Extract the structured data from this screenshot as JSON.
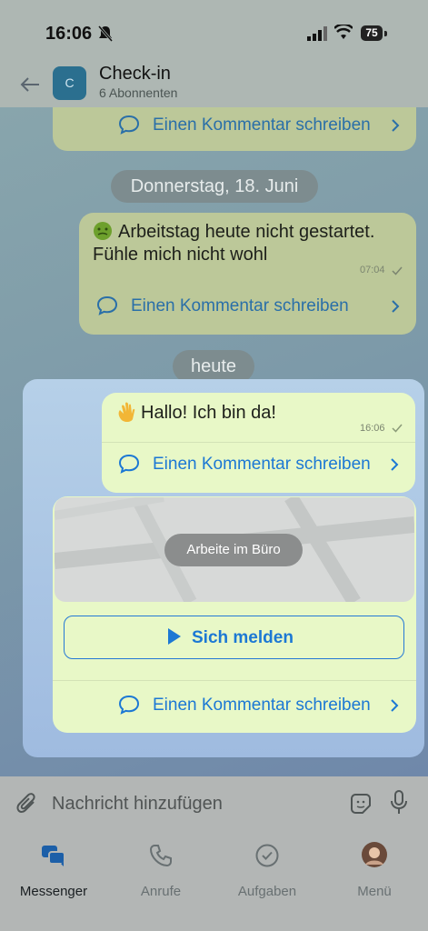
{
  "status_bar": {
    "time": "16:06",
    "battery": "75"
  },
  "header": {
    "title": "Check-in",
    "subtitle": "6 Abonnenten",
    "avatar_letter": "C"
  },
  "messages": {
    "comment_label": "Einen Kommentar schreiben",
    "date_divider": "Donnerstag, 18. Juni",
    "msg1_text": "Arbeitstag heute nicht gestartet. Fühle mich nicht wohl",
    "msg1_time": "07:04",
    "today_divider": "heute",
    "msg2_text": "Hallo! Ich bin da!",
    "msg2_time": "16:06",
    "map_label": "Arbeite im Büro",
    "checkin_button": "Sich melden"
  },
  "composer": {
    "placeholder": "Nachricht hinzufügen"
  },
  "tabs": [
    {
      "label": "Messenger",
      "icon": "chat-bubbles-icon",
      "active": true
    },
    {
      "label": "Anrufe",
      "icon": "phone-icon",
      "active": false
    },
    {
      "label": "Aufgaben",
      "icon": "checkmark-circle-icon",
      "active": false
    },
    {
      "label": "Menü",
      "icon": "profile-avatar-icon",
      "active": false
    }
  ],
  "colors": {
    "accent": "#1c78d4",
    "active_tab": "#1c5fa8"
  }
}
